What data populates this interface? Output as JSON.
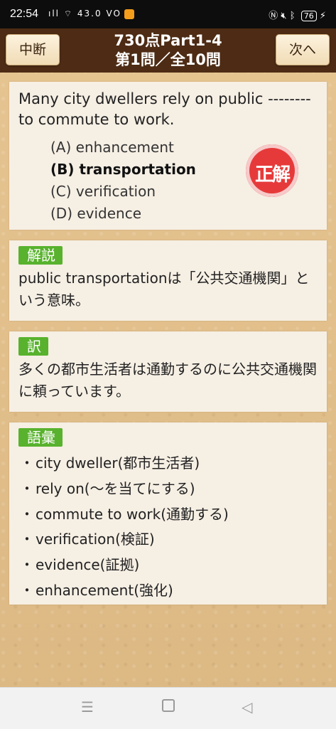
{
  "status_bar": {
    "time": "22:54",
    "network_left": "ıll ⌔ 43.0 VO",
    "battery": "76"
  },
  "header": {
    "title_line1": "730点Part1-4",
    "title_line2": "第1問／全10問",
    "left_button": "中断",
    "right_button": "次へ"
  },
  "question": {
    "text": "Many city dwellers rely on public -------- to commute to work.",
    "choices": [
      "(A) enhancement",
      "(B) transportation",
      "(C) verification",
      "(D) evidence"
    ],
    "correct_index": 1,
    "result_badge": "正解"
  },
  "explanation": {
    "label": "解説",
    "text": "public transportationは「公共交通機関」という意味。"
  },
  "translation": {
    "label": "訳",
    "text": "多くの都市生活者は通勤するのに公共交通機関に頼っています。"
  },
  "vocabulary": {
    "label": "語彙",
    "items": [
      "city dweller(都市生活者)",
      "rely on(〜を当てにする)",
      "commute to work(通勤する)",
      "verification(検証)",
      "evidence(証拠)",
      "enhancement(強化)"
    ]
  },
  "colors": {
    "header_bg": "#4d2b14",
    "label_green": "#58b22d",
    "badge_red": "#e63a3a"
  }
}
